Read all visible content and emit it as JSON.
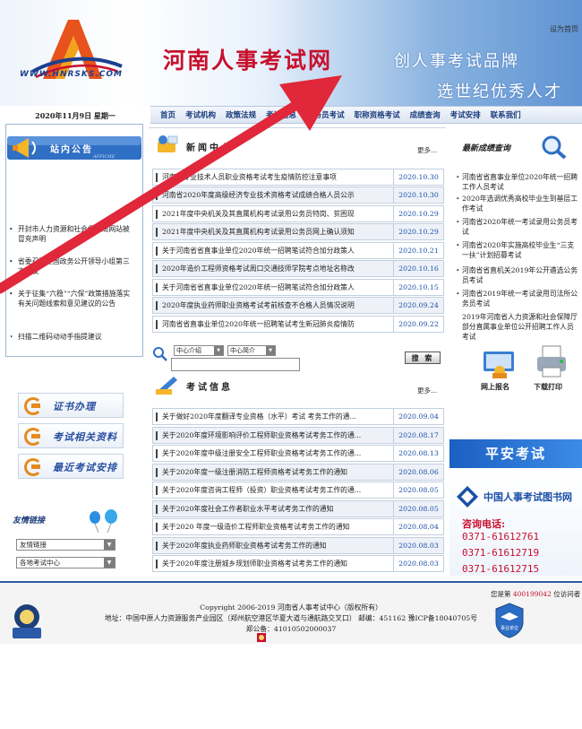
{
  "header": {
    "logo_text": "WWW.HNRSKS.COM",
    "site_title": "河南人事考试网",
    "slogan_line1": "创人事考试品牌",
    "slogan_line2": "选世纪优秀人才",
    "set_homepage": "设为首页"
  },
  "nav": {
    "items": [
      "首页",
      "考试机构",
      "政策法规",
      "考试信息",
      "公务员考试",
      "职称资格考试",
      "成绩查询",
      "考试安排",
      "联系我们"
    ]
  },
  "left": {
    "date": "2020年11月9日 星期一",
    "notice_title": "站内公告",
    "notice_sub": "AFFICHE",
    "notices": [
      "开封市人力资源和社会保障局网站被冒充声明",
      "省委召开全国政务公开领导小组第三次会议",
      "关于征集“六稳”“六保”政策措施落实有关问题线索和意见建议的公告",
      "扫描二维码动动手指提建议"
    ],
    "side_buttons": [
      "证书办理",
      "考试相关资料",
      "最近考试安排"
    ],
    "links_title": "友情链接",
    "select1": "友情链接",
    "select2": "各地考试中心"
  },
  "news": {
    "title": "新闻中心",
    "more": "更多...",
    "rows": [
      {
        "title": "河南省专业技术人员职业资格考试考生疫情防控注意事项",
        "date": "2020.10.30"
      },
      {
        "title": "河南省2020年度高级经济专业技术资格考试成绩合格人员公示",
        "date": "2020.10.30"
      },
      {
        "title": "2021年度中央机关及其直属机构考试录用公务员特岗、贫困现",
        "date": "2020.10.29"
      },
      {
        "title": "2021年度中央机关及其直属机构考试录用公务员网上确认须知",
        "date": "2020.10.29"
      },
      {
        "title": "关于河南省省直事业单位2020年统一招聘笔试符合加分政策人",
        "date": "2020.10.21"
      },
      {
        "title": "2020年造价工程师资格考试周口交通技师学院考点地址名称改",
        "date": "2020.10.16"
      },
      {
        "title": "关于河南省省直事业单位2020年统一招聘笔试符合加分政策人",
        "date": "2020.10.15"
      },
      {
        "title": "2020年度执业药师职业资格考试考前核查不合格人员情况说明",
        "date": "2020.09.24"
      },
      {
        "title": "河南省省直事业单位2020年统一招聘笔试考生新冠肺炎疫情防",
        "date": "2020.09.22"
      }
    ]
  },
  "search": {
    "select1": "中心介绍",
    "select2": "中心简介",
    "button": "搜 索"
  },
  "exam": {
    "title": "考试信息",
    "more": "更多...",
    "rows": [
      {
        "title": "关于做好2020年度翻译专业资格（水平）考试 考务工作的通...",
        "date": "2020.09.04"
      },
      {
        "title": "关于2020年度环境影响评价工程师职业资格考试考务工作的通...",
        "date": "2020.08.17"
      },
      {
        "title": "关于2020年度中级注册安全工程师职业资格考试考务工作的通...",
        "date": "2020.08.13"
      },
      {
        "title": "关于2020年度一级注册消防工程师资格考试考务工作的通知",
        "date": "2020.08.06"
      },
      {
        "title": "关于2020年度咨询工程师（投资）职业资格考试考务工作的通...",
        "date": "2020.08.05"
      },
      {
        "title": "关于2020年度社会工作者职业水平考试考务工作的通知",
        "date": "2020.08.05"
      },
      {
        "title": "关于2020 年度一级造价工程师职业资格考试考务工作的通知",
        "date": "2020.08.04"
      },
      {
        "title": "关于2020年度执业药师职业资格考试考务工作的通知",
        "date": "2020.08.03"
      },
      {
        "title": "关于2020年度注册城乡规划师职业资格考试考务工作的通知",
        "date": "2020.08.03"
      }
    ]
  },
  "right": {
    "score_title": "最新成绩查询",
    "scores": [
      "河南省省直事业单位2020年统一招聘工作人员考试",
      "2020年选调优秀高校毕业生到基层工作考试",
      "河南省2020年统一考试录用公务员考试",
      "河南省2020年实施高校毕业生“三支一扶”计划招募考试",
      "河南省省直机关2019年公开遴选公务员考试",
      "河南省2019年统一考试录用司法所公务员考试",
      "2019年河南省人力资源和社会保障厅部分直属事业单位公开招聘工作人员考试"
    ],
    "online_register": "网上报名",
    "download_print": "下载打印",
    "pingan": "平安考试",
    "books_title": "中国人事考试图书网",
    "consult_label": "咨询电话:",
    "phones": [
      "0371-61612761",
      "0371-61612719",
      "0371-61612715"
    ]
  },
  "footer": {
    "visitor_prefix": "您是第",
    "visitor_count": "400199042",
    "visitor_suffix": "位访问者",
    "copyright": "Copyright 2006-2019 河南省人事考试中心（版权所有）",
    "address": "地址：中国中原人力资源服务产业园区（郑州航空港区华夏大道与通航路交叉口） 邮编：451162 豫ICP备18040705号",
    "beian": "郑公备：41010502000037",
    "badge_text": "事业单位"
  },
  "colors": {
    "brand_red": "#c8102e",
    "nav_blue": "#1a3c7c",
    "date_blue": "#1a4fa8",
    "accent_orange": "#e68a1e"
  }
}
